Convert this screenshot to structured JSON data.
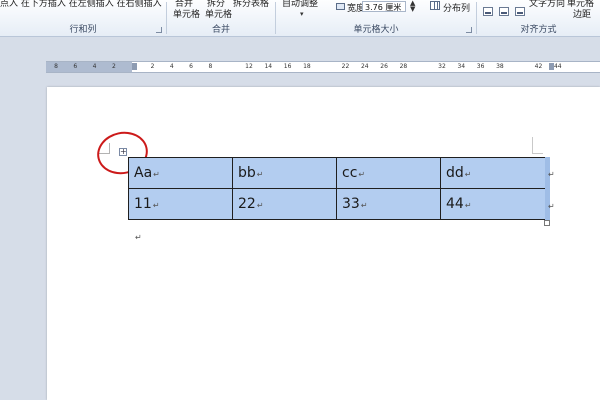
{
  "ribbon": {
    "insert_rows_text": "点入 在下方插入 在左侧插入 在右侧插入",
    "merge_cells_top": "合并",
    "merge_cells_bottom": "单元格",
    "split_cells_top": "拆分",
    "split_cells_bottom": "单元格",
    "split_table_text": "拆分表格",
    "autofit_text": "自动调整",
    "width_label": "宽度:",
    "width_value": "3.76 厘米",
    "spin_up": "▲",
    "spin_down": "▼",
    "dropdown_arrow": "▾",
    "distribute_cols": "分布列",
    "text_direction": "文字方向",
    "cell_margins_top": "单元格",
    "cell_margins_bottom": "边距",
    "groups": {
      "rows_cols": "行和列",
      "merge": "合并",
      "cell_size": "单元格大小",
      "alignment": "对齐方式"
    }
  },
  "ruler": {
    "ticks": [
      "8",
      "6",
      "4",
      "2",
      "",
      "2",
      "4",
      "6",
      "8",
      "",
      "12",
      "14",
      "16",
      "18",
      "",
      "22",
      "24",
      "26",
      "28",
      "",
      "32",
      "34",
      "36",
      "38",
      "",
      "42",
      "44"
    ]
  },
  "document": {
    "move_handle_glyph": "+",
    "table": [
      [
        "Aa",
        "bb",
        "cc",
        "dd"
      ],
      [
        "11",
        "22",
        "33",
        "44"
      ]
    ],
    "cell_mark": "↵",
    "paragraph_mark": "↵"
  },
  "colors": {
    "selection": "#b3cdf0",
    "annotation_circle": "#cc1a1a",
    "workspace": "#d6dde8"
  }
}
